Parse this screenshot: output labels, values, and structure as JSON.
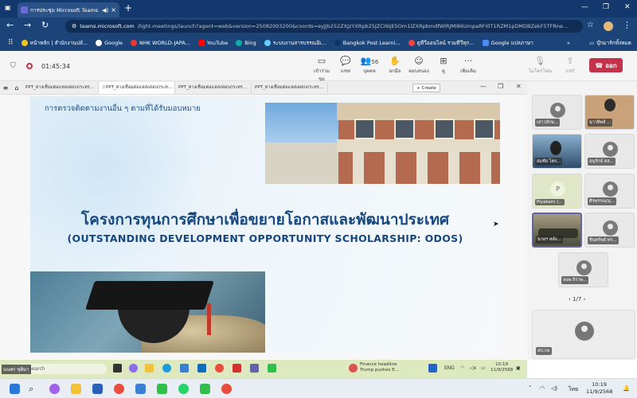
{
  "browser": {
    "tab_title": "การประชุม Microsoft Teams |",
    "new_tab": "+",
    "window_controls": [
      "—",
      "❐",
      "✕"
    ],
    "url_host": "teams.microsoft.com",
    "url_path": "/light-meetings/launch?agent=web&version=25082003200&coords=eyJjb252ZXJzYXRpb25JZCI6IjE5Om1lZXRpbmdfWlRJMl86UmpaRFI0T1RZM1pDMDBZekF5TFRne...",
    "bookmarks": [
      "หน้าหลัก | สำนักงานปลั...",
      "Google",
      "NHK WORLD-JAPA...",
      "YouTube",
      "Bing",
      "ระบบงานสารบรรณอิเ...",
      "Bangkok Post Learni...",
      "ดูทีวีออนไลน์ รวมทีวีทุก...",
      "Google แปลภาษา"
    ],
    "bookmark_more": "»",
    "bookmark_folder": "บุ๊กมาร์กทั้งหมด"
  },
  "teams": {
    "timer": "01:45:34",
    "toolbar": [
      {
        "id": "join",
        "label": "เข้าร่วมชุม",
        "icon": "▭"
      },
      {
        "id": "chat",
        "label": "แชท",
        "icon": "💬"
      },
      {
        "id": "people",
        "label": "บุคคล",
        "icon": "👥",
        "count": "56"
      },
      {
        "id": "raise",
        "label": "ยกมือ",
        "icon": "✋"
      },
      {
        "id": "react",
        "label": "ตอบสนอง",
        "icon": "☺"
      },
      {
        "id": "view",
        "label": "ดู",
        "icon": "⊞"
      },
      {
        "id": "more",
        "label": "เพิ่มเติม",
        "icon": "···"
      },
      {
        "id": "mic",
        "label": "ไมโครโฟน",
        "icon": "🎙"
      },
      {
        "id": "share",
        "label": "แชร์",
        "icon": "⇧"
      }
    ],
    "leave_label": "ออก"
  },
  "ppt": {
    "tabs": [
      "PPT_ทางเชื่อมต่อแหล่งสอบกระทร...",
      "PPT_ทางเชื่อมต่อแหล่งสอบกระท...",
      "PPT_ทางเชื่อมต่อแหล่งสอบกระทร...",
      "PPT_ทางเชื่อมต่อแหล่งสอบกระทร..."
    ],
    "create_label": "+ Create"
  },
  "slide": {
    "subtitle": "การตรวจติดตามงานอื่น ๆ ตามที่ได้รับมอบหมาย",
    "title_th": "โครงการทุนการศึกษาเพื่อขยายโอกาสและพัฒนาประเทศ",
    "title_en": "(OUTSTANDING DEVELOPMENT OPPORTUNITY SCHOLARSHIP: ODOS)"
  },
  "participants": [
    {
      "name": "เสาวลักษ..."
    },
    {
      "name": "นาวทิพย์ ..."
    },
    {
      "name": "สมชัย ไตร..."
    },
    {
      "name": "อนุรักษ์ หล..."
    },
    {
      "name": "Piyakorn (..."
    },
    {
      "name": "ศิรพรรณ(มุ..."
    },
    {
      "name": "นายฯ หลัง..."
    },
    {
      "name": "ชินทรัพย์ ทร..."
    },
    {
      "name": "ลอพ.จิราพ..."
    }
  ],
  "participant_initial": "P",
  "pager": "1/7",
  "big_tile_name": "สป.กษ",
  "shared_taskbar": {
    "overlay_name": "นนพร ชุติมา",
    "search_placeholder": "Search",
    "news_line1": "Finance headline",
    "news_line2": "Trump pushes E...",
    "lang": "ENG",
    "time": "10:19",
    "date": "11/9/2568"
  },
  "taskbar": {
    "lang": "ไทย",
    "time": "10:19",
    "date": "11/9/2568"
  }
}
